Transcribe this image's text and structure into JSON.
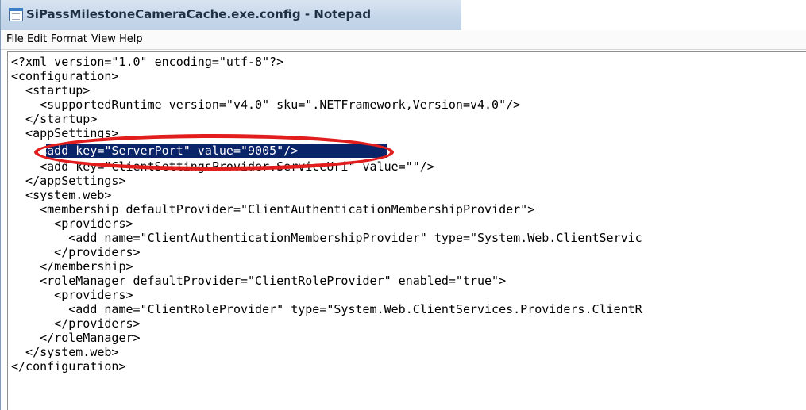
{
  "window": {
    "title": "SiPassMilestoneCameraCache.exe.config - Notepad"
  },
  "menu": {
    "file": "File",
    "edit": "Edit",
    "format": "Format",
    "view": "View",
    "help": "Help"
  },
  "editor": {
    "lines": [
      "<?xml version=\"1.0\" encoding=\"utf-8\"?>",
      "<configuration>",
      "  <startup>",
      "    <supportedRuntime version=\"v4.0\" sku=\".NETFramework,Version=v4.0\"/>",
      "  </startup>",
      "  <appSettings>",
      "    <add key=\"ServerPort\" value=\"9005\"/>",
      "    <add key=\"ClientSettingsProvider.ServiceUri\" value=\"\"/>",
      "  </appSettings>",
      "  <system.web>",
      "    <membership defaultProvider=\"ClientAuthenticationMembershipProvider\">",
      "      <providers>",
      "        <add name=\"ClientAuthenticationMembershipProvider\" type=\"System.Web.ClientServic",
      "      </providers>",
      "    </membership>",
      "    <roleManager defaultProvider=\"ClientRoleProvider\" enabled=\"true\">",
      "      <providers>",
      "        <add name=\"ClientRoleProvider\" type=\"System.Web.ClientServices.Providers.ClientR",
      "      </providers>",
      "    </roleManager>",
      "  </system.web>",
      "</configuration>"
    ],
    "selected_line_index": 6,
    "selected_text": "<add key=\"ServerPort\" value=\"9005\"/>"
  },
  "colors": {
    "selection": "#0a246a",
    "annotation": "#e11d1d"
  }
}
